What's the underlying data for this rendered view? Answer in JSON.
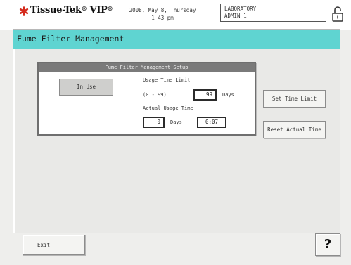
{
  "header": {
    "logo_text": "Tissue-Tek",
    "logo_sub": "®",
    "logo_model": " VIP",
    "logo_sup": "®",
    "date_line": "2008, May 8, Thursday",
    "time_line": "1 43 pm",
    "location": "LABORATORY",
    "user": "ADMIN 1",
    "lock_icon": "padlock-open-icon"
  },
  "page": {
    "title": "Fume Filter Management"
  },
  "setup": {
    "title": "Fume Filter Management Setup",
    "status_button": "In Use",
    "usage_limit_label": "Usage Time Limit",
    "usage_limit_range": "(0 - 99)",
    "usage_limit_value": "99",
    "usage_limit_unit": "Days",
    "actual_label": "Actual Usage Time",
    "actual_days_value": "0",
    "actual_days_unit": "Days",
    "actual_time_value": "0:07"
  },
  "buttons": {
    "set_time_limit": "Set Time Limit",
    "reset_actual_time": "Reset Actual Time",
    "exit": "Exit",
    "help": "?"
  },
  "colors": {
    "title_bar": "#5fd4d1",
    "logo_mark": "#d42a1c"
  }
}
